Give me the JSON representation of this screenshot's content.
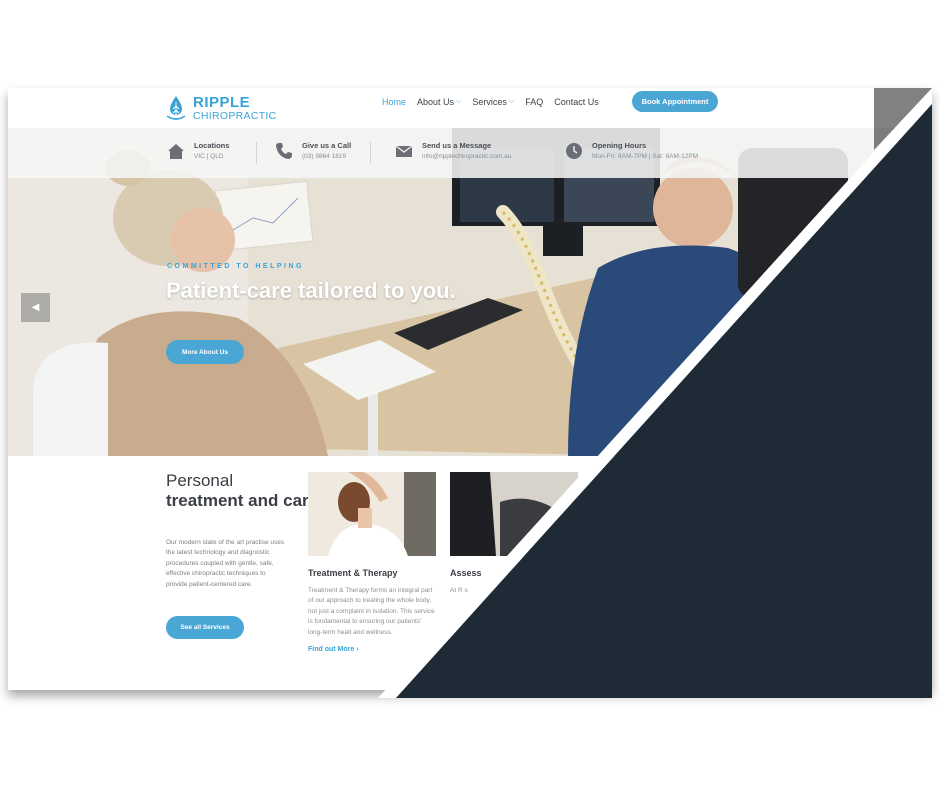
{
  "brand": {
    "name_top": "RIPPLE",
    "name_bottom": "CHIROPRACTIC"
  },
  "nav": {
    "items": [
      {
        "label": "Home",
        "has_dropdown": false,
        "active": true
      },
      {
        "label": "About Us",
        "has_dropdown": true,
        "active": false
      },
      {
        "label": "Services",
        "has_dropdown": true,
        "active": false
      },
      {
        "label": "FAQ",
        "has_dropdown": false,
        "active": false
      },
      {
        "label": "Contact Us",
        "has_dropdown": false,
        "active": false
      }
    ],
    "cta": "Book Appointment"
  },
  "info_bar": {
    "locations": {
      "title": "Locations",
      "sub": "VIC | QLD",
      "icon": "home-icon"
    },
    "call": {
      "title": "Give us a Call",
      "sub": "(03) 9864 1819",
      "icon": "phone-icon"
    },
    "message": {
      "title": "Send us a Message",
      "sub": "info@ripplechiropractic.com.au",
      "icon": "mail-icon"
    },
    "hours": {
      "title": "Opening Hours",
      "sub": "Mon-Fri: 8AM-7PM | Sat: 8AM-12PM",
      "icon": "clock-icon"
    }
  },
  "hero": {
    "kicker": "COMMITTED TO HELPING",
    "title": "Patient-care tailored to you.",
    "button": "More About Us",
    "prev_icon": "chevron-left-icon"
  },
  "intro": {
    "title_light": "Personal",
    "title_bold": "treatment and care",
    "description": "Our modern state of the art practise uses the latest technology and diagnostic procedures coupled with gentle, safe, effective chiropractic techniques to provide patient-centered care.",
    "button": "See all Services"
  },
  "cards": [
    {
      "title": "Treatment & Therapy",
      "description": "Treatment & Therapy forms an integral part of our approach to treating the whole body, not just a complaint in isolation. This service is fundamental to ensuring our patients' long-term healt and wellness.",
      "link": "Find out More ›"
    },
    {
      "title": "Assess",
      "description": "At R s",
      "link": ""
    }
  ],
  "colors": {
    "accent": "#4aa7d5",
    "dark_panel": "#1f2a37",
    "text": "#3b3f45"
  }
}
